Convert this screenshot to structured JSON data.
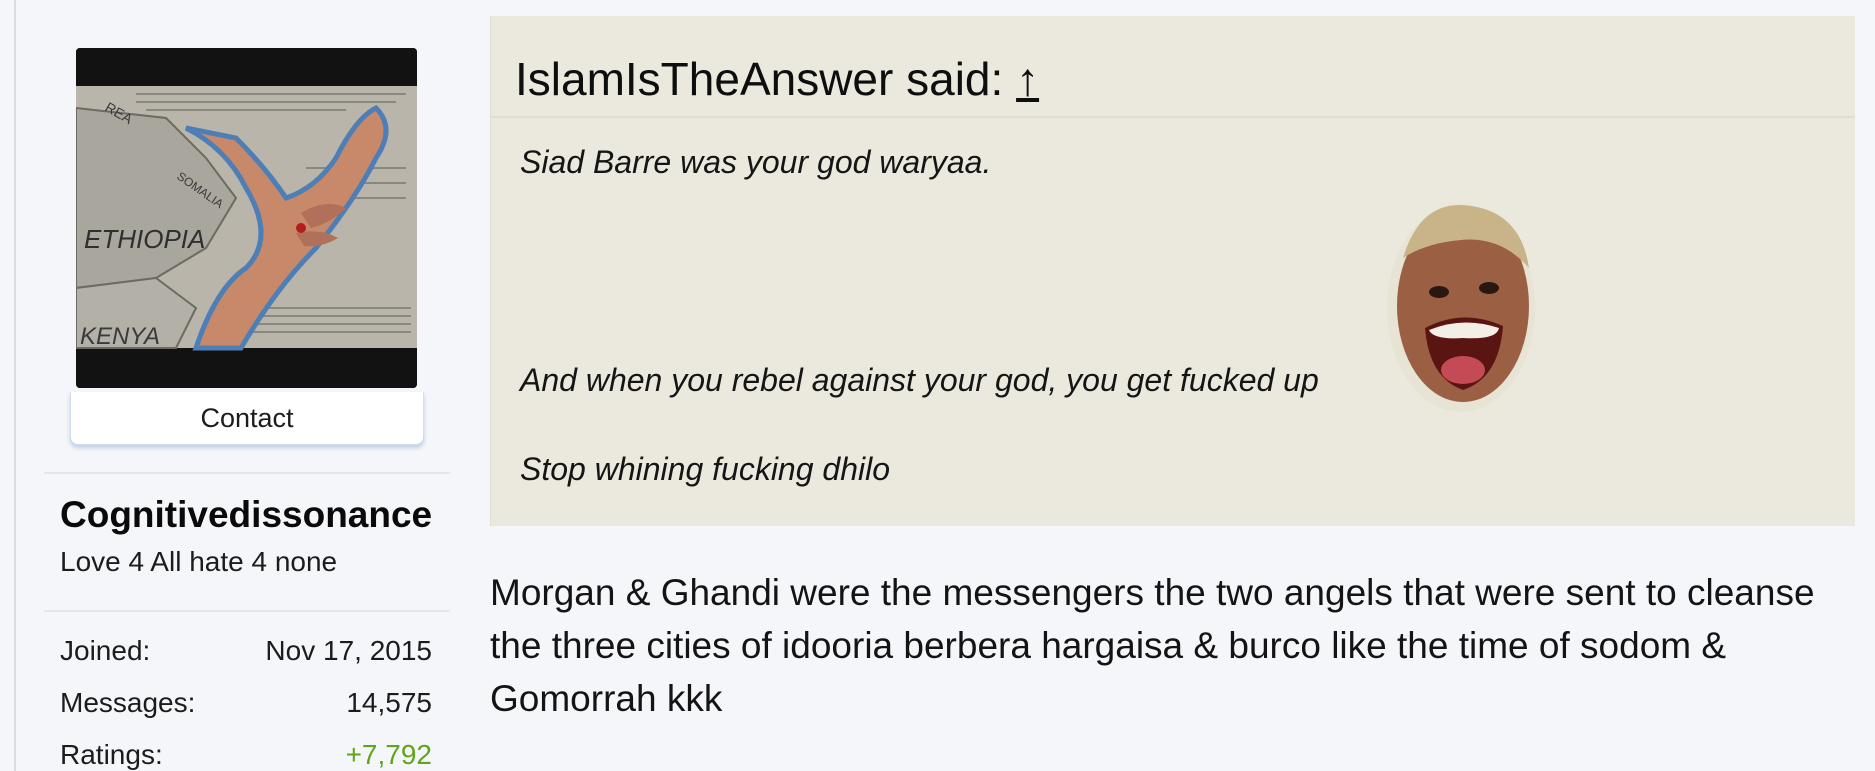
{
  "user": {
    "contact_label": "Contact",
    "username": "Cognitivedissonance",
    "title": "Love 4 All hate 4 none",
    "avatar_map_labels": [
      "ETHIOPIA",
      "KENYA",
      "SOMALIA",
      "REA"
    ],
    "stats": [
      {
        "label": "Joined:",
        "value": "Nov 17, 2015"
      },
      {
        "label": "Messages:",
        "value": "14,575"
      },
      {
        "label": "Ratings:",
        "value": "+7,792"
      }
    ],
    "ratings_color": "#5fa51a"
  },
  "quote": {
    "header": "IslamIsTheAnswer said:",
    "arrow": "↑",
    "lines": [
      "Siad Barre was your god waryaa.",
      "And when you rebel against your god, you get fucked up",
      "Stop whining fucking dhilo"
    ],
    "background": "#ebe9de"
  },
  "post": {
    "text": "Morgan & Ghandi were the messengers the two angels that were sent to cleanse the three cities of idooria berbera hargaisa & burco like the time of sodom & Gomorrah kkk"
  }
}
